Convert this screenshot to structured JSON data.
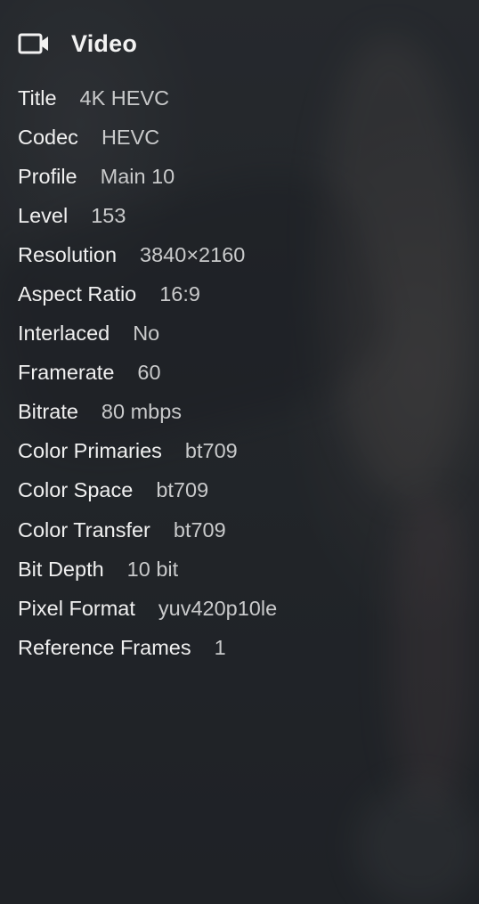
{
  "panel": {
    "title": "Video",
    "icon": "video-camera-icon"
  },
  "properties": [
    {
      "label": "Title",
      "value": "4K HEVC"
    },
    {
      "label": "Codec",
      "value": "HEVC"
    },
    {
      "label": "Profile",
      "value": "Main 10"
    },
    {
      "label": "Level",
      "value": "153"
    },
    {
      "label": "Resolution",
      "value": "3840×2160"
    },
    {
      "label": "Aspect Ratio",
      "value": "16:9"
    },
    {
      "label": "Interlaced",
      "value": "No"
    },
    {
      "label": "Framerate",
      "value": "60"
    },
    {
      "label": "Bitrate",
      "value": "80 mbps"
    },
    {
      "label": "Color Primaries",
      "value": "bt709"
    },
    {
      "label": "Color Space",
      "value": "bt709"
    },
    {
      "label": "Color Transfer",
      "value": "bt709"
    },
    {
      "label": "Bit Depth",
      "value": "10 bit"
    },
    {
      "label": "Pixel Format",
      "value": "yuv420p10le"
    },
    {
      "label": "Reference Frames",
      "value": "1"
    }
  ]
}
